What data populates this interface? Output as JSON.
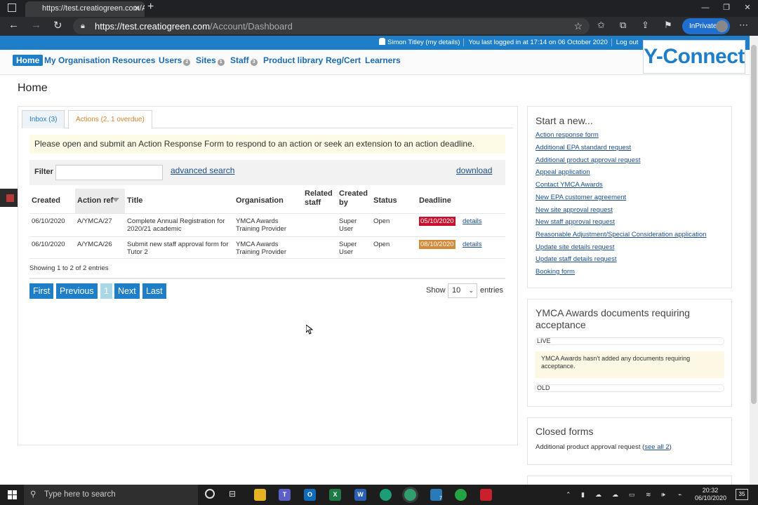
{
  "browser": {
    "tab_title": "https://test.creatiogreen.com/Ac",
    "url_host": "https://test.creatiogreen.com",
    "url_path": "/Account/Dashboard",
    "inprivate_label": "InPrivate"
  },
  "sitebar": {
    "user_link": "Simon Titley (my details)",
    "last_login": "You last logged in at 17:14 on 06 October 2020",
    "logout": "Log out",
    "logo": "Y-Connect"
  },
  "nav": {
    "items": [
      {
        "label": "Home"
      },
      {
        "label": "My Organisation"
      },
      {
        "label": "Resources"
      },
      {
        "label": "Users",
        "badge": "2"
      },
      {
        "label": "Sites",
        "badge": "1"
      },
      {
        "label": "Staff",
        "badge": "3"
      },
      {
        "label": "Product library"
      },
      {
        "label": "Reg/Cert"
      },
      {
        "label": "Learners"
      }
    ]
  },
  "page_title": "Home",
  "tabs": [
    {
      "label": "Inbox (3)"
    },
    {
      "label": "Actions (2, 1 overdue)"
    }
  ],
  "notice": "Please open and submit an Action Response Form to respond to an action or seek an extension to an action deadline.",
  "filter": {
    "label": "Filter",
    "advanced_search": "advanced search",
    "download": "download"
  },
  "table": {
    "headers": [
      "Created",
      "Action ref",
      "Title",
      "Organisation",
      "Related staff",
      "Created by",
      "Status",
      "Deadline"
    ],
    "rows": [
      {
        "created": "06/10/2020",
        "ref": "A/YMCA/27",
        "title": "Complete Annual Registration for 2020/21 academic",
        "org": "YMCA Awards Training Provider",
        "related": "",
        "created_by": "Super User",
        "status": "Open",
        "deadline": "05/10/2020",
        "details": "details"
      },
      {
        "created": "06/10/2020",
        "ref": "A/YMCA/26",
        "title": "Submit new staff approval form for Tutor 2",
        "org": "YMCA Awards Training Provider",
        "related": "",
        "created_by": "Super User",
        "status": "Open",
        "deadline": "08/10/2020",
        "details": "details"
      }
    ],
    "showing": "Showing 1 to 2 of 2 entries",
    "pager": {
      "first": "First",
      "previous": "Previous",
      "current": "1",
      "next": "Next",
      "last": "Last"
    },
    "show_label": "Show",
    "page_size": "10",
    "entries_label": "entries"
  },
  "start_new": {
    "title": "Start a new...",
    "links": [
      "Action response form",
      "Additional EPA standard request",
      "Additional product approval request",
      "Appeal application",
      "Contact YMCA Awards",
      "New EPA customer agreement",
      "New site approval request",
      "New staff approval request",
      "Reasonable Adjustment/Special Consideration application",
      "Update site details request",
      "Update staff details request",
      "Booking form"
    ]
  },
  "documents": {
    "title": "YMCA Awards documents requiring acceptance",
    "live": "LIVE",
    "message": "YMCA Awards hasn't added any documents requiring acceptance.",
    "old": "OLD"
  },
  "closed_forms": {
    "title": "Closed forms",
    "text": "Additional product approval request (",
    "link": "see all 2",
    "close": ")"
  },
  "taskbar": {
    "search_placeholder": "Type here to search",
    "time": "20:32",
    "date": "06/10/2020",
    "notifications": "35",
    "edge_badge": "7"
  },
  "colors": {
    "brand_blue": "#1e7ec8",
    "overdue_red": "#c8102e",
    "due_orange": "#d58a3a",
    "actions_tab_orange": "#d5832a"
  }
}
